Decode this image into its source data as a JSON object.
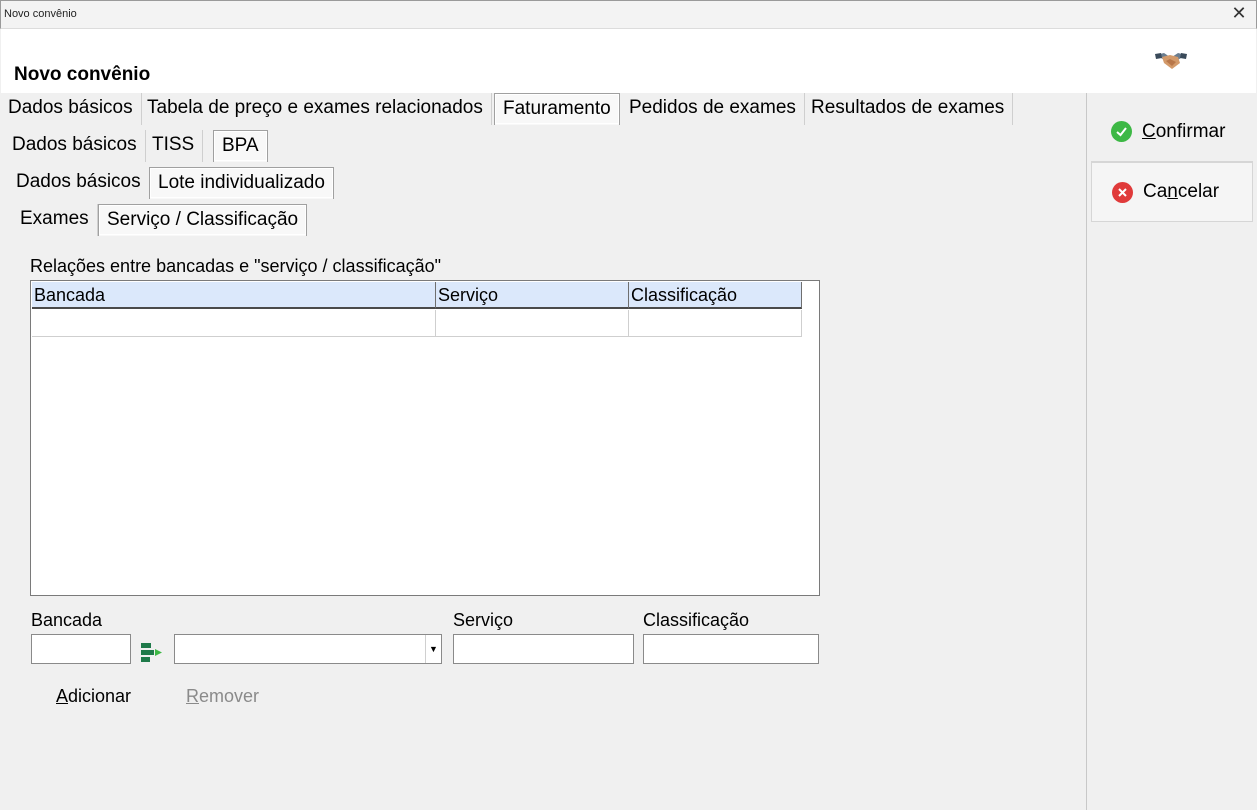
{
  "window": {
    "title": "Novo convênio",
    "close_label": "✕"
  },
  "header": {
    "title": "Novo convênio"
  },
  "tabs_level1": [
    {
      "label": "Dados básicos"
    },
    {
      "label": "Tabela de preço e exames relacionados"
    },
    {
      "label": "Faturamento"
    },
    {
      "label": "Pedidos de exames"
    },
    {
      "label": "Resultados de exames"
    }
  ],
  "tabs_level2": [
    {
      "label": "Dados básicos"
    },
    {
      "label": "TISS"
    },
    {
      "label": "BPA"
    }
  ],
  "tabs_level3": [
    {
      "label": "Dados básicos"
    },
    {
      "label": "Lote individualizado"
    }
  ],
  "tabs_level4": [
    {
      "label": "Exames"
    },
    {
      "label": "Serviço / Classificação"
    }
  ],
  "section": {
    "label": "Relações entre bancadas e \"serviço / classificação\""
  },
  "grid": {
    "columns": [
      "Bancada",
      "Serviço",
      "Classificação"
    ],
    "rows": [
      [
        "",
        "",
        ""
      ]
    ]
  },
  "form": {
    "bancada_label": "Bancada",
    "bancada_value": "",
    "bancada_select_value": "",
    "servico_label": "Serviço",
    "servico_value": "",
    "classificacao_label": "Classificação",
    "classificacao_value": ""
  },
  "actions": {
    "add": {
      "first": "A",
      "rest": "dicionar"
    },
    "remove": {
      "first": "R",
      "rest": "emover"
    }
  },
  "side": {
    "confirm": {
      "first": "C",
      "rest": "onfirmar"
    },
    "cancel": {
      "pre": "Ca",
      "u": "n",
      "post": "celar"
    }
  },
  "colors": {
    "grid_header": "#dbe8fb",
    "confirm_icon": "#3db845",
    "cancel_icon": "#e03a3a",
    "disabled_text": "#8a8a8a"
  }
}
